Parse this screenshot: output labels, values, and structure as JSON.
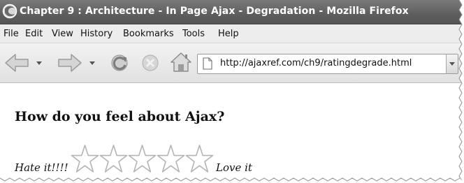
{
  "window": {
    "title": "Chapter 9 : Architecture - In Page Ajax - Degradation - Mozilla Firefox"
  },
  "menu": {
    "items": [
      "File",
      "Edit",
      "View",
      "History",
      "Bookmarks",
      "Tools",
      "Help"
    ]
  },
  "toolbar": {
    "url": "http://ajaxref.com/ch9/ratingdegrade.html",
    "icons": [
      "back-arrow-icon",
      "forward-arrow-icon",
      "reload-icon",
      "stop-icon",
      "home-icon",
      "page-icon"
    ]
  },
  "page": {
    "heading": "How do you feel about Ajax?",
    "rating": {
      "low_label": "Hate it!!!!",
      "high_label": "Love it",
      "star_count": 5,
      "selected": 0
    }
  }
}
